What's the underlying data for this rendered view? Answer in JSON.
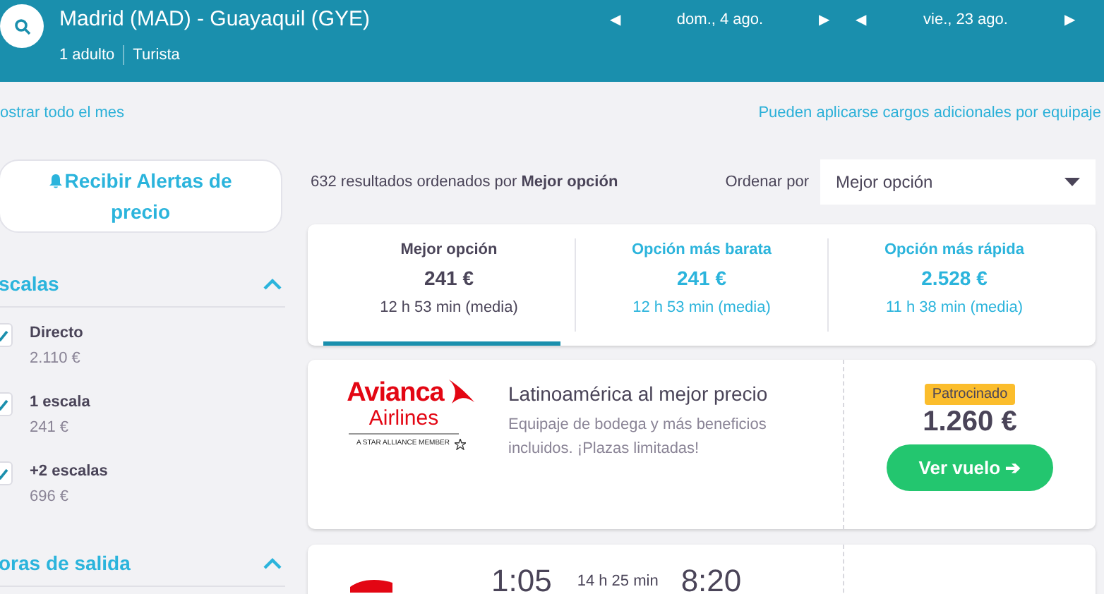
{
  "header": {
    "route": "Madrid (MAD) - Guayaquil (GYE)",
    "passengers": "1 adulto",
    "cabin": "Turista",
    "dates": [
      {
        "label": "dom., 4 ago.",
        "prev": "◀",
        "next": "▶"
      },
      {
        "label": "vie., 23 ago.",
        "prev": "◀",
        "next": "▶"
      }
    ]
  },
  "month_link": "ostrar todo el mes",
  "fees_link": "Pueden aplicarse cargos adicionales por equipaje",
  "alert_button": "Recibir Alertas de precio",
  "filters": [
    {
      "title": "scalas",
      "expanded": true,
      "options": [
        {
          "label": "Directo",
          "price": "2.110 €",
          "checked": true
        },
        {
          "label": "1 escala",
          "price": "241 €",
          "checked": true
        },
        {
          "label": "+2 escalas",
          "price": "696 €",
          "checked": true
        }
      ]
    },
    {
      "title": "oras de salida",
      "expanded": true
    }
  ],
  "results_summary": "632 resultados ordenados por **Mejor opción**",
  "sort": {
    "label": "Ordenar por",
    "value": "Mejor opción"
  },
  "tabs": [
    {
      "label": "Mejor opción",
      "price": "241 €",
      "duration": "12 h 53 min (media)",
      "selected": true
    },
    {
      "label": "Opción más barata",
      "price": "241 €",
      "duration": "12 h 53 min (media)",
      "selected": false
    },
    {
      "label": "Opción más rápida",
      "price": "2.528 €",
      "duration": "11 h 38 min (media)",
      "selected": false
    }
  ],
  "ad": {
    "logo_name": "Avianca",
    "logo_sub": "Airlines",
    "alliance": "A STAR ALLIANCE MEMBER",
    "title": "Latinoamérica al mejor precio",
    "text": "Equipaje de bodega y más beneficios incluidos. ¡Plazas limitadas!",
    "badge": "Patrocinado",
    "price": "1.260 €",
    "button": "Ver vuelo ➔"
  },
  "flight": {
    "departure": "1:05",
    "duration": "14 h 25 min",
    "arrival": "8:20"
  }
}
